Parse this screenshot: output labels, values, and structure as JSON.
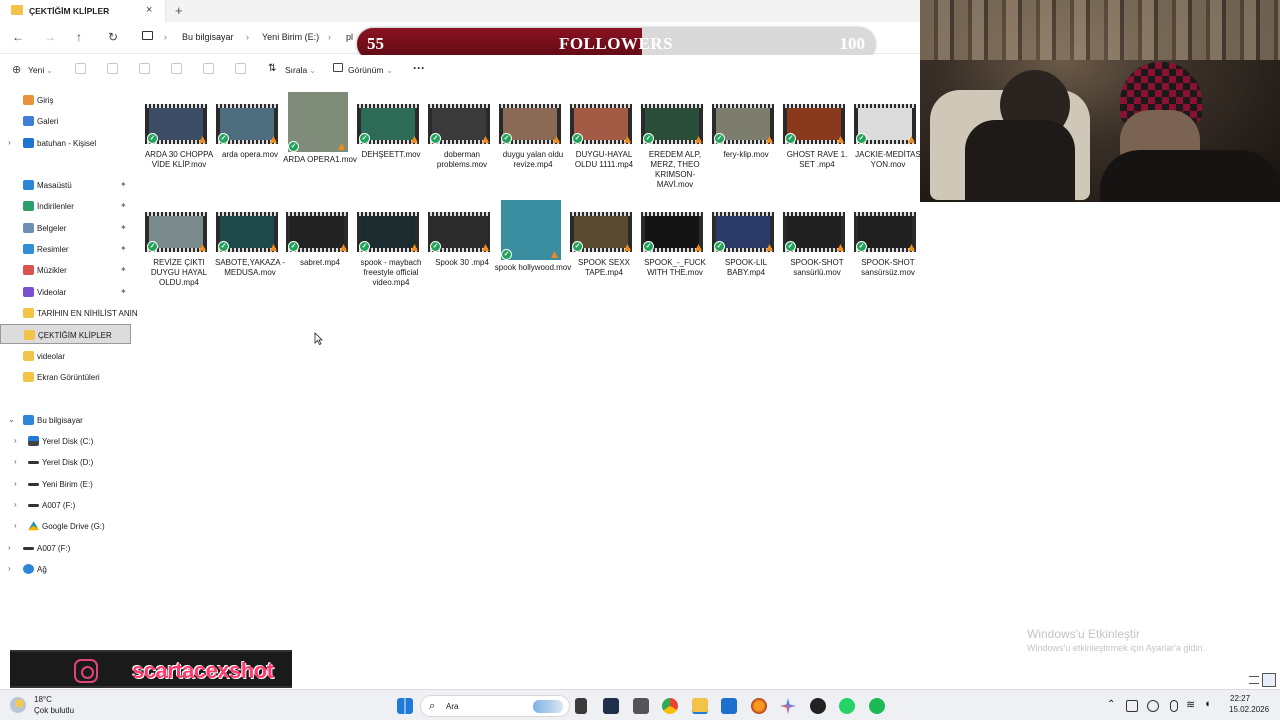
{
  "window": {
    "tab_title": "ÇEKTİĞİM KLİPLER",
    "close": "×",
    "new_tab": "+"
  },
  "nav": {
    "back": "←",
    "forward": "→",
    "up": "↑",
    "refresh": "↻",
    "crumbs": [
      "Bu bilgisayar",
      "Yeni Birim (E:)",
      "pl"
    ],
    "sep": "›"
  },
  "followers_bar": {
    "current": "55",
    "label": "FOLLOWERS",
    "goal": "100",
    "progress": 0.55,
    "color": "#8b1220"
  },
  "toolbar": {
    "new": "Yeni",
    "sort": "Sırala",
    "view": "Görünüm",
    "more": "···"
  },
  "sidebar": {
    "quick": [
      {
        "label": "Giriş",
        "icon": "home-icon",
        "color": "#e8913a"
      },
      {
        "label": "Galeri",
        "icon": "gallery-icon",
        "color": "#3d7fd6"
      },
      {
        "label": "batuhan - Kişisel",
        "icon": "onedrive-icon",
        "color": "#1f74d1",
        "chevron": true
      }
    ],
    "pinned": [
      {
        "label": "Masaüstü",
        "icon": "desktop-icon",
        "color": "#2b86d8"
      },
      {
        "label": "İndirilenler",
        "icon": "download-icon",
        "color": "#2aa06a"
      },
      {
        "label": "Belgeler",
        "icon": "documents-icon",
        "color": "#6d8fb3"
      },
      {
        "label": "Resimler",
        "icon": "pictures-icon",
        "color": "#2f8fd9"
      },
      {
        "label": "Müzikler",
        "icon": "music-icon",
        "color": "#d9534f"
      },
      {
        "label": "Videolar",
        "icon": "videos-icon",
        "color": "#7a4fd1"
      }
    ],
    "folders": [
      {
        "label": "TARİHIN EN NİHİLİST ANIN",
        "icon": "folder-icon"
      },
      {
        "label": "ÇEKTİĞİM KLİPLER",
        "icon": "folder-icon",
        "selected": true
      },
      {
        "label": "videolar",
        "icon": "folder-icon"
      },
      {
        "label": "Ekran Görüntüleri",
        "icon": "folder-icon"
      }
    ],
    "this_pc": "Bu bilgisayar",
    "drives": [
      {
        "label": "Yerel Disk (C:)",
        "icon": "windows-drive-icon"
      },
      {
        "label": "Yerel Disk (D:)",
        "icon": "drive-icon"
      },
      {
        "label": "Yeni Birim (E:)",
        "icon": "drive-icon"
      },
      {
        "label": "A007 (F:)",
        "icon": "drive-icon"
      },
      {
        "label": "Google Drive (G:)",
        "icon": "google-drive-icon"
      }
    ],
    "extra": [
      {
        "label": "A007 (F:)",
        "icon": "drive-icon"
      },
      {
        "label": "Ağ",
        "icon": "network-icon"
      }
    ]
  },
  "files_row1": [
    {
      "name": "ARDA 30 CHOPPA VİDE KLİP.mov",
      "color": "#3b4c64"
    },
    {
      "name": "arda opera.mov",
      "color": "#4e6d7e"
    },
    {
      "name": "ARDA OPERA1.mov",
      "color": "#7f8c7a",
      "tall": true
    },
    {
      "name": "DEHŞEETT.mov",
      "color": "#2e6b57"
    },
    {
      "name": "doberman problems.mov",
      "color": "#3a3a3a"
    },
    {
      "name": "duygu yalan oldu revize.mp4",
      "color": "#8a6a55"
    },
    {
      "name": "DUYGU-HAYAL OLDU 1111.mp4",
      "color": "#a25a45"
    },
    {
      "name": "EREDEM ALP, MERZ, THEO KRIMSON- MAVİ.mov",
      "color": "#2a4d3a"
    },
    {
      "name": "fery-klip.mov",
      "color": "#7d7d6f"
    },
    {
      "name": "GHOST RAVE 1. SET .mp4",
      "color": "#8a3a1c"
    },
    {
      "name": "JACKIE-MEDİTAS YON.mov",
      "color": "#dcdcdc"
    }
  ],
  "files_row2": [
    {
      "name": "REVİZE ÇIKTI DUYGU HAYAL OLDU.mp4",
      "color": "#7b8a8c"
    },
    {
      "name": "SABOTE,YAKAZA - MEDUSA.mov",
      "color": "#1f4a4c"
    },
    {
      "name": "sabret.mp4",
      "color": "#222222"
    },
    {
      "name": "spook - maybach freestyle official video.mp4",
      "color": "#1c2b2e"
    },
    {
      "name": "Spook 30 .mp4",
      "color": "#2c2c2c"
    },
    {
      "name": "spook hollywood.mov",
      "color": "#3a8ea0",
      "tall": true
    },
    {
      "name": "SPOOK SEXX TAPE.mp4",
      "color": "#5a4a30"
    },
    {
      "name": "SPOOK_-_FUCK WITH THE.mov",
      "color": "#141414"
    },
    {
      "name": "SPOOK-LIL BABY.mp4",
      "color": "#2b3a66"
    },
    {
      "name": "SPOOK-SHOT sansürlü.mov",
      "color": "#202020"
    },
    {
      "name": "SPOOK-SHOT sansürsüz.mov",
      "color": "#202020"
    }
  ],
  "watermark": {
    "line1": "Windows'u Etkinleştir",
    "line2": "Windows'u etkinleştirmek için Ayarlar'a gidin."
  },
  "overlay": {
    "handle": "scartacexshot"
  },
  "taskbar": {
    "temp": "18°C",
    "weather": "Çok bulutlu",
    "search": "Ara",
    "time": "22:27",
    "date": "15.02.2026"
  }
}
